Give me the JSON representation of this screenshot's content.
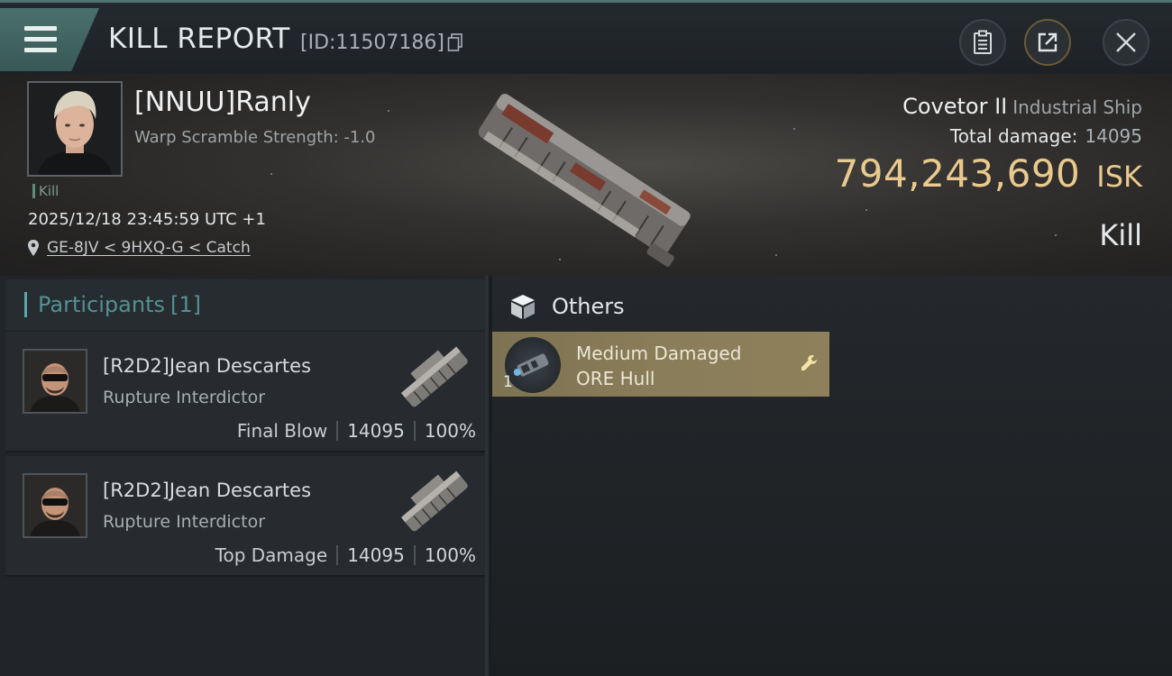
{
  "header": {
    "title": "KILL REPORT",
    "report_id": "[ID:11507186]"
  },
  "victim": {
    "name": "[NNUU]Ranly",
    "warp_scramble": "Warp Scramble Strength: -1.0",
    "tag": "Kill",
    "timestamp": "2025/12/18 23:45:59 UTC +1",
    "location": "GE-8JV < 9HXQ-G < Catch"
  },
  "ship": {
    "name": "Covetor II",
    "class": "Industrial Ship",
    "total_damage_label": "Total damage:",
    "total_damage": "14095",
    "isk_value": "794,243,690",
    "isk_unit": "ISK",
    "kill_type": "Kill"
  },
  "participants": {
    "label": "Participants",
    "count": "[1]",
    "rows": [
      {
        "name": "[R2D2]Jean Descartes",
        "ship": "Rupture Interdictor",
        "role": "Final Blow",
        "damage": "14095",
        "percent": "100%"
      },
      {
        "name": "[R2D2]Jean Descartes",
        "ship": "Rupture Interdictor",
        "role": "Top Damage",
        "damage": "14095",
        "percent": "100%"
      }
    ]
  },
  "others": {
    "label": "Others",
    "items": [
      {
        "line1": "Medium Damaged",
        "line2": "ORE Hull",
        "quantity": "1"
      }
    ]
  },
  "icons": {
    "menu": "menu-icon",
    "copy": "copy-icon",
    "clipboard": "clipboard-icon",
    "share": "share-icon",
    "close": "close-icon",
    "location": "location-pin-icon",
    "box": "box-icon",
    "wrench": "wrench-icon"
  },
  "colors": {
    "accent_teal": "#4e7470",
    "isk_gold": "#e9c98d",
    "item_card": "#8a7d59",
    "participants_label": "#55908f"
  }
}
